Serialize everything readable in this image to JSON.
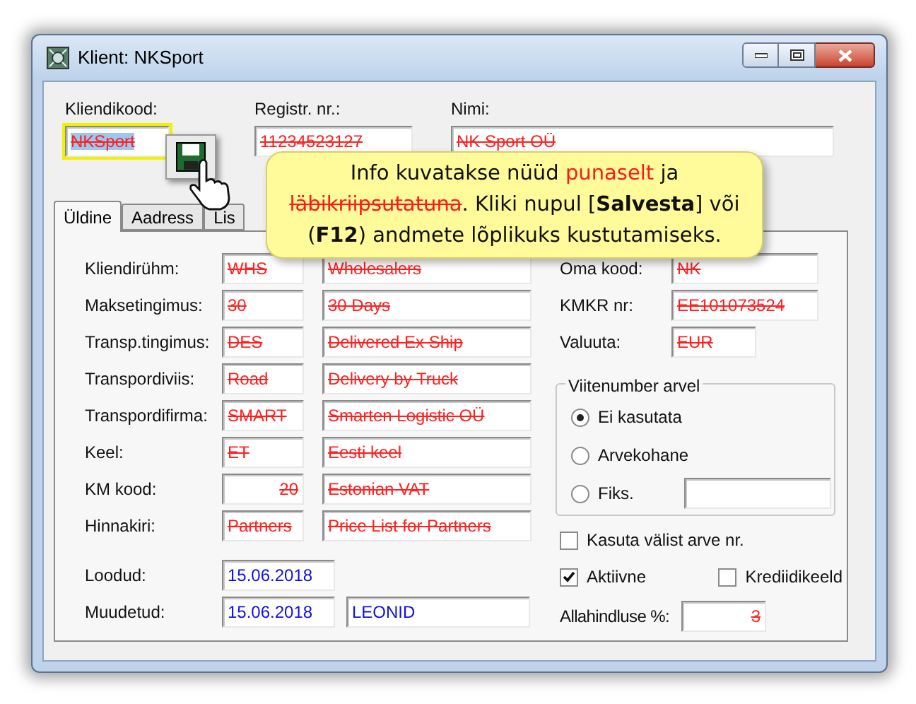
{
  "window": {
    "title": "Klient: NKSport"
  },
  "header_fields": [
    {
      "label": "Kliendikood:",
      "value": "NKSport",
      "deleted": true,
      "selected": true,
      "highlighted": true
    },
    {
      "label": "Registr. nr.:",
      "value": "11234523127",
      "deleted": true,
      "selected": false,
      "highlighted": false
    },
    {
      "label": "Nimi:",
      "value": "NK Sport OÜ",
      "deleted": true,
      "selected": false,
      "highlighted": false
    }
  ],
  "tabs": [
    {
      "label": "Üldine",
      "selected": true
    },
    {
      "label": "Aadress",
      "selected": false
    },
    {
      "label": "Lis",
      "selected": false
    }
  ],
  "left_rows": [
    {
      "label": "Kliendirühm:",
      "code": "WHS",
      "name": "Wholesalers",
      "deleted": true,
      "kind": "text"
    },
    {
      "label": "Maksetingimus:",
      "code": "30",
      "name": "30 Days",
      "deleted": true,
      "kind": "text"
    },
    {
      "label": "Transp.tingimus:",
      "code": "DES",
      "name": "Delivered Ex Ship",
      "deleted": true,
      "kind": "text"
    },
    {
      "label": "Transpordiviis:",
      "code": "Road",
      "name": "Delivery by Truck",
      "deleted": true,
      "kind": "text"
    },
    {
      "label": "Transpordifirma:",
      "code": "SMART",
      "name": "Smarten Logistic OÜ",
      "deleted": true,
      "kind": "text"
    },
    {
      "label": "Keel:",
      "code": "ET",
      "name": "Eesti keel",
      "deleted": true,
      "kind": "text"
    },
    {
      "label": "KM kood:",
      "code": "20",
      "name": "Estonian VAT",
      "deleted": true,
      "kind": "number"
    },
    {
      "label": "Hinnakiri:",
      "code": "Partners",
      "name": "Price List for Partners",
      "deleted": true,
      "kind": "text"
    }
  ],
  "date_rows": [
    {
      "label": "Loodud:",
      "values": [
        "15.06.2018"
      ],
      "deleted": false
    },
    {
      "label": "Muudetud:",
      "values": [
        "15.06.2018",
        "LEONID"
      ],
      "deleted": false
    }
  ],
  "right_rows": [
    {
      "label": "Oma kood:",
      "value": "NK",
      "deleted": true
    },
    {
      "label": "KMKR nr:",
      "value": "EE101073524",
      "deleted": true
    },
    {
      "label": "Valuuta:",
      "value": "EUR",
      "deleted": true
    }
  ],
  "reference_group": {
    "title": "Viitenumber arvel",
    "options": [
      {
        "label": "Ei kasutata",
        "selected": true,
        "kind": "plain"
      },
      {
        "label": "Arvekohane",
        "selected": false,
        "kind": "plain"
      },
      {
        "label": "Fiks.",
        "selected": false,
        "kind": "with_field"
      }
    ]
  },
  "checkboxes": [
    {
      "label": "Kasuta välist arve nr.",
      "checked": false
    },
    {
      "label": "Aktiivne",
      "checked": true
    },
    {
      "label": "Krediidikeeld",
      "checked": false
    }
  ],
  "discount": {
    "label": "Allahindluse %:",
    "value": "3",
    "deleted": true
  },
  "tooltip": {
    "segments": [
      {
        "text": "Info kuvatakse nüüd ",
        "kind": "plain"
      },
      {
        "text": "punaselt",
        "kind": "red"
      },
      {
        "text": " ja ",
        "kind": "plain"
      },
      {
        "text": "läbikriipsutatuna",
        "kind": "red_strike"
      },
      {
        "text": ". Kliki nupul [",
        "kind": "plain"
      },
      {
        "text": "Salvesta",
        "kind": "bold"
      },
      {
        "text": "] või (",
        "kind": "plain"
      },
      {
        "text": "F12",
        "kind": "bold"
      },
      {
        "text": ") andmete lõplikuks kustutamiseks.",
        "kind": "plain"
      }
    ]
  }
}
